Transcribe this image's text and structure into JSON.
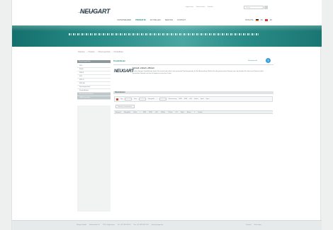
{
  "brand": {
    "logo_text": "NEUGART"
  },
  "header": {
    "top_links": [
      "Impressum",
      "Datenschutz",
      "Kontakt"
    ],
    "search_placeholder": "Suche",
    "main_nav": [
      {
        "label": "UNTERNEHMEN",
        "active": false
      },
      {
        "label": "PRODUKTE",
        "active": true
      },
      {
        "label": "AKTUELLES",
        "active": false
      },
      {
        "label": "SERVICE",
        "active": false
      },
      {
        "label": "KONTAKT",
        "active": false
      }
    ],
    "language_label": "SPRACHE",
    "languages": [
      "DE",
      "EN"
    ]
  },
  "breadcrumb": [
    "Startseite",
    "Produkte",
    "Planetengetriebe",
    "Produktfinder"
  ],
  "sidebar": {
    "heading": "Planetengetriebe",
    "items": [
      {
        "label": "PLE",
        "highlighted": false
      },
      {
        "label": "PLHE",
        "highlighted": false
      },
      {
        "label": "WPLE",
        "highlighted": false
      },
      {
        "label": "PLN",
        "highlighted": false
      },
      {
        "label": "WPLN",
        "highlighted": false
      },
      {
        "label": "WPLHE",
        "highlighted": false
      },
      {
        "label": "Spezialgetriebe",
        "highlighted": false
      },
      {
        "label": "Produktfinder",
        "highlighted": false
      },
      {
        "label": "Auslegungssoftware",
        "highlighted": true
      },
      {
        "label": "CAD-Download",
        "highlighted": true
      }
    ]
  },
  "content": {
    "section_title": "Produktfinder",
    "print_label": "Druckansicht",
    "help_icon": "?",
    "product_title": "Schnell, einfach, effizient",
    "product_description": "Mit dem Neugart Produktfinder finden Sie schnell und einfach das passende Planetengetriebe für Ihre Anwendung. Wählen Sie die gewünschten Kriterien aus und erhalten Sie sofort eine Übersicht aller passenden Getriebe mit den wichtigsten technischen Daten.",
    "group_label": "Filterkriterien",
    "toolbar_items": [
      "Typ",
      "Bau",
      "Baugröße",
      "i",
      "Übersetzung",
      "M2N",
      "M2B",
      "n1N",
      "Stufen",
      "Spiel",
      "Spez."
    ],
    "filter_button": "Kriterien zurücksetzen",
    "table_columns": [
      "Bauserie",
      "Baugröße",
      "Stufe",
      "i",
      "M2N",
      "M2B",
      "n1N",
      "n1Max",
      "T2max",
      "C2t",
      "Spiel",
      "Masse",
      "J",
      "Details"
    ]
  },
  "footer": {
    "links": [
      "Neugart GmbH",
      "Keltenstraße 16",
      "77971 Kippenheim",
      "Tel. +49 7825 847-0",
      "Fax +49 7825 847-102",
      "sales@neugart.de"
    ],
    "right_links": [
      "Drucken",
      "Nach oben"
    ]
  },
  "colors": {
    "accent": "#1e8b86",
    "banner": "#2b8e89",
    "help_icon": "#3a9fd8"
  }
}
